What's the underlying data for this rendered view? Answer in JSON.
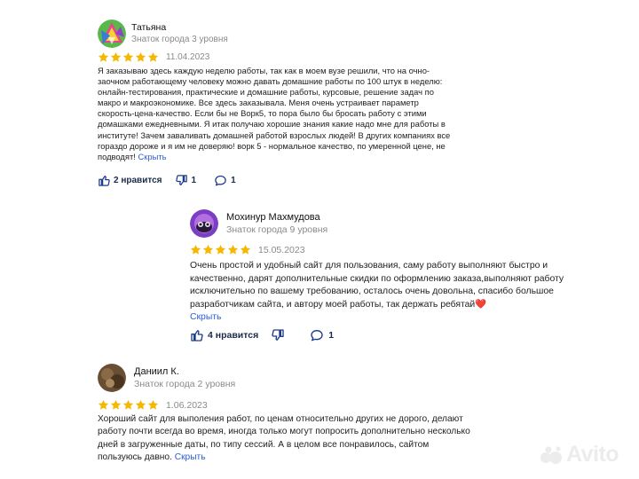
{
  "reviews": [
    {
      "author": "Татьяна",
      "level": "Знаток города 3 уровня",
      "rating": 5,
      "date": "11.04.2023",
      "text": "Я заказываю здесь каждую неделю работы, так как в моем вузе решили, что на очно-заочном работающему человеку можно давать домашние работы по 100 штук в неделю: онлайн-тестирования, практические и домашние работы, курсовые, решение задач по макро и макроэкономике. Все здесь заказывала. Меня очень устраивает параметр скорость-цена-качество. Если бы не Ворк5, то пора было бы бросать работу с этими домашками ежедневными. Я итак получаю хорошие знания какие надо мне для работы в институте! Зачем заваливать домашней работой взрослых людей! В других компаниях все гораздо дороже и я им не доверяю! ворк 5 - нормальное качество, по умеренной цене, не подводят!",
      "toggle": "Скрыть",
      "likes": "2 нравится",
      "dislikes": "1",
      "comments": "1"
    },
    {
      "author": "Мохинур Махмудова",
      "level": "Знаток города 9 уровня",
      "rating": 5,
      "date": "15.05.2023",
      "text": "Очень простой и удобный сайт для пользования, саму работу выполняют быстро и качественно, дарят дополнительные скидки по оформлению заказа,выполняют работу исключительно по вашему требованию, осталось очень довольна, спасибо большое разработчикам сайта, и автору моей работы, так держать ребятай❤️",
      "toggle": "Скрыть",
      "likes": "4 нравится",
      "dislikes": "",
      "comments": "1"
    },
    {
      "author": "Даниил К.",
      "level": "Знаток города 2 уровня",
      "rating": 5,
      "date": "1.06.2023",
      "text": "Хороший сайт для выполения работ, по ценам относительно других не дорого, делают работу почти всегда во время, иногда только могут попросить дополнительно несколько дней в загруженные даты, по типу сессий. А в целом все понравилось, сайтом пользуюсь давно.",
      "toggle": "Скрыть"
    }
  ],
  "watermark": "Avito",
  "colors": {
    "star": "#f5b700",
    "link": "#2b5cd9",
    "icon": "#1a3a8a"
  }
}
